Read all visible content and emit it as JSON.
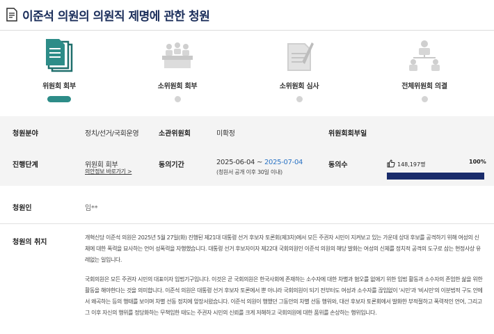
{
  "page": {
    "title": "이준석 의원의 의원직 제명에 관한 청원",
    "title_icon": "document-icon"
  },
  "steps": [
    {
      "label": "위원회 회부",
      "icon": "documents-icon",
      "active": true
    },
    {
      "label": "소위원회 회부",
      "icon": "meeting-table-icon",
      "active": false
    },
    {
      "label": "소위원회 심사",
      "icon": "review-document-icon",
      "active": false
    },
    {
      "label": "전체위원회 의결",
      "icon": "org-chart-icon",
      "active": false
    }
  ],
  "info": {
    "field_label": "청원분야",
    "field_value": "정치/선거/국회운영",
    "committee_label": "소관위원회",
    "committee_value": "미확정",
    "subcommittee_label": "위원회회부일",
    "subcommittee_value": "",
    "stage_label": "진행단계",
    "stage_value": "위원회 회부",
    "stage_link": "의안정보 바로가기 >",
    "period_label": "동의기간",
    "period_start": "2025-06-04 ~ ",
    "period_end": "2025-07-04",
    "period_note": "(청원서 공개 이후 30일 이내)",
    "consent_label": "동의수",
    "consent_count": "148,197명",
    "consent_percent": "100%",
    "consent_progress": 1.0,
    "consent_icon": "thumbs-up-icon"
  },
  "petitioner": {
    "label": "청원인",
    "value": "임**"
  },
  "purpose": {
    "label": "청원의 취지",
    "paragraph1": "개혁신당 이준석 의원은 2025년 5월 27일(화) 진행된 제21대 대통령 선거 후보자 토론회(제3차)에서 모든 주권자 시민이 지켜보고 있는 가운데 상대 후보를 공격하기 위해 여성의 신체에 대한 폭력을 묘사하는 언어 성폭력을 자행했습니다. 대통령 선거 후보자이자 제22대 국회의원인 이준석 의원의 해당 발화는 여성의 신체를 정치적 공격의 도구로 삼는 현정사상 유례없는 일입니다.",
    "paragraph2": "국회의원은 모든 주권자 시민의 대표이자 입법기구입니다. 이것은 곧 국회의원은 한국사회에 존재하는 소수자에 대한 차별과 혐오를 없애기 위한 입법 활동과 소수자의 존엄한 삶을 위한 활동을 해야한다는 것을 의미합니다. 이준석 의원은 대통령 선거 후보자 토론에서 뿐 아니라 국회의원이 되기 전부터도 여성과 소수자를 끊임없이 '시민'과 '비시민'의 이분법적 구도 안에서 왜곡하는 등의 행태를 보이며 차별 선동 정치에 앞장서왔습니다. 이준석 의원이 행했던 그동안의 차별 선동 행위와, 대선 후보자 토론회에서 발화한 부적절하고 폭력적인 언어, 그리고 그 이후 자신의 행위를 정당화하는 무책임한 태도는 주권자 시민의 신뢰를 크게 저해하고 국회의원에 대한 품위를 손상하는 행위입니다."
  },
  "colors": {
    "title": "#1a2d5a",
    "active_step": "#2d8c88",
    "progress": "#1a2c6b",
    "date_end": "#2a73c4"
  }
}
